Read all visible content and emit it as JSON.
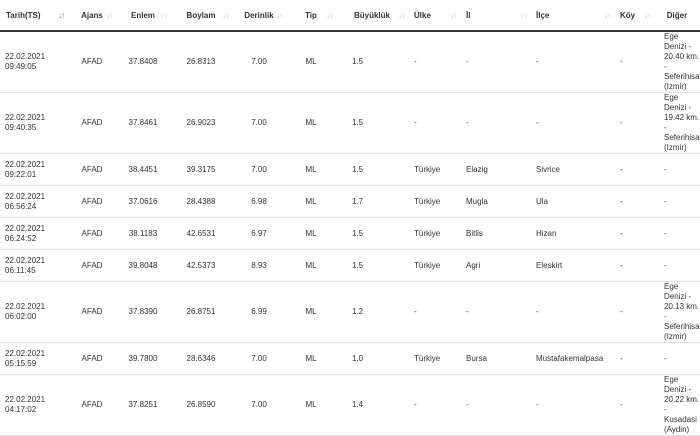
{
  "table": {
    "columns": [
      {
        "label": "Tarih(TS)",
        "sort_icon": "sort-desc-icon",
        "active": true
      },
      {
        "label": "Ajans",
        "sort_icon": "sort-icon"
      },
      {
        "label": "Enlem",
        "sort_icon": "sort-icon"
      },
      {
        "label": "Boylam",
        "sort_icon": "sort-icon"
      },
      {
        "label": "Derinlik",
        "sort_icon": "sort-icon"
      },
      {
        "label": "Tip",
        "sort_icon": "sort-icon"
      },
      {
        "label": "Büyüklük",
        "sort_icon": "sort-icon"
      },
      {
        "label": "Ülke",
        "sort_icon": "sort-icon"
      },
      {
        "label": "İl",
        "sort_icon": "sort-icon"
      },
      {
        "label": "İlçe",
        "sort_icon": "sort-icon"
      },
      {
        "label": "Köy",
        "sort_icon": "sort-icon"
      },
      {
        "label": "Diğer",
        "sort_icon": ""
      }
    ],
    "rows": [
      {
        "date": "22.02.2021",
        "time": "09:49:05",
        "agency": "AFAD",
        "lat": "37.8408",
        "lon": "26.8313",
        "depth": "7.00",
        "type": "ML",
        "mag": "1.5",
        "country": "-",
        "province": "-",
        "district": "-",
        "village": "-",
        "other": [
          "Ege Denizi -",
          "20.40 km. -",
          "Seferihisar",
          "(Izmir)"
        ]
      },
      {
        "date": "22.02.2021",
        "time": "09:40:35",
        "agency": "AFAD",
        "lat": "37.8461",
        "lon": "26.9023",
        "depth": "7.00",
        "type": "ML",
        "mag": "1.5",
        "country": "-",
        "province": "-",
        "district": "-",
        "village": "-",
        "other": [
          "Ege Denizi -",
          "19.42 km. -",
          "Seferihisar",
          "(Izmir)"
        ]
      },
      {
        "date": "22.02.2021",
        "time": "09:22:01",
        "agency": "AFAD",
        "lat": "38.4451",
        "lon": "39.3175",
        "depth": "7.00",
        "type": "ML",
        "mag": "1.5",
        "country": "Türkiye",
        "province": "Elazig",
        "district": "Sivrice",
        "village": "-",
        "other": [
          "-"
        ]
      },
      {
        "date": "22.02.2021",
        "time": "06:56:24",
        "agency": "AFAD",
        "lat": "37.0616",
        "lon": "28.4388",
        "depth": "6.98",
        "type": "ML",
        "mag": "1.7",
        "country": "Türkiye",
        "province": "Mugla",
        "district": "Ula",
        "village": "-",
        "other": [
          "-"
        ]
      },
      {
        "date": "22.02.2021",
        "time": "06:24:52",
        "agency": "AFAD",
        "lat": "38.1183",
        "lon": "42.6531",
        "depth": "6.97",
        "type": "ML",
        "mag": "1.5",
        "country": "Türkiye",
        "province": "Bitlis",
        "district": "Hizan",
        "village": "-",
        "other": [
          "-"
        ]
      },
      {
        "date": "22.02.2021",
        "time": "06:11:45",
        "agency": "AFAD",
        "lat": "39.8048",
        "lon": "42.5373",
        "depth": "8.93",
        "type": "ML",
        "mag": "1.5",
        "country": "Türkiye",
        "province": "Agri",
        "district": "Eleskirt",
        "village": "-",
        "other": [
          "-"
        ]
      },
      {
        "date": "22.02.2021",
        "time": "06:02:00",
        "agency": "AFAD",
        "lat": "37.8390",
        "lon": "26.8751",
        "depth": "6.99",
        "type": "ML",
        "mag": "1.2",
        "country": "-",
        "province": "-",
        "district": "-",
        "village": "-",
        "other": [
          "Ege Denizi -",
          "20.13 km. -",
          "Seferihisar",
          "(Izmir)"
        ]
      },
      {
        "date": "22.02.2021",
        "time": "05:15:59",
        "agency": "AFAD",
        "lat": "39.7800",
        "lon": "28.6346",
        "depth": "7.00",
        "type": "ML",
        "mag": "1.0",
        "country": "Türkiye",
        "province": "Bursa",
        "district": "Mustafakemalpasa",
        "village": "-",
        "other": [
          "-"
        ]
      },
      {
        "date": "22.02.2021",
        "time": "04:17:02",
        "agency": "AFAD",
        "lat": "37.8251",
        "lon": "26.8590",
        "depth": "7.00",
        "type": "ML",
        "mag": "1.4",
        "country": "-",
        "province": "-",
        "district": "-",
        "village": "-",
        "other": [
          "Ege Denizi -",
          "20.22 km. -",
          "Kusadasi",
          "(Aydin)"
        ]
      }
    ]
  }
}
